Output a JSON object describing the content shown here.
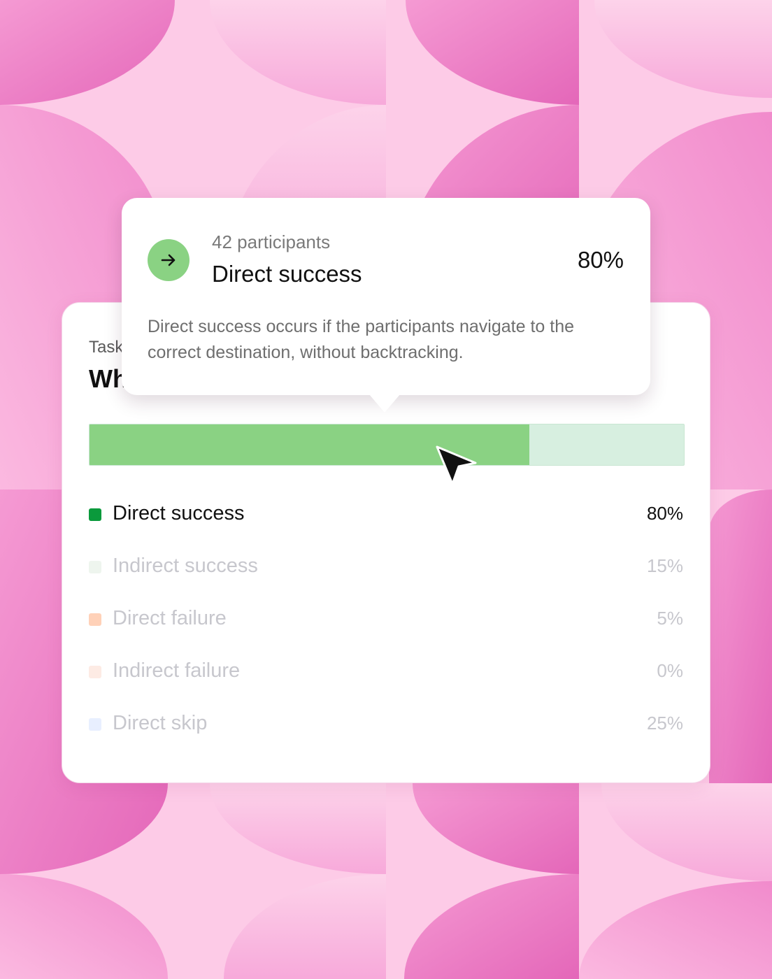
{
  "colors": {
    "background": "#fcc9e6",
    "circle_pink": "#ec79c4",
    "success_green": "#8ad283",
    "success_remaining": "#d7efe0"
  },
  "card": {
    "task_label": "Task",
    "task_title": "Wh"
  },
  "progress": {
    "direct_success_fraction": 0.74
  },
  "legend": [
    {
      "label": "Direct success",
      "value": "80%",
      "color": "#0a9a3c",
      "state": "active"
    },
    {
      "label": "Indirect success",
      "value": "15%",
      "color": "#eef5ee",
      "state": "muted"
    },
    {
      "label": "Direct failure",
      "value": "5%",
      "color": "#ffd1b8",
      "state": "muted"
    },
    {
      "label": "Indirect failure",
      "value": "0%",
      "color": "#fdebe4",
      "state": "muted"
    },
    {
      "label": "Direct skip",
      "value": "25%",
      "color": "#e8efff",
      "state": "muted"
    }
  ],
  "tooltip": {
    "icon": "arrow-right-icon",
    "participants": "42 participants",
    "title": "Direct success",
    "value": "80%",
    "description": "Direct success occurs if the participants navigate to the correct destination, without backtracking."
  },
  "pointer": {
    "icon": "mouse-pointer-icon"
  }
}
